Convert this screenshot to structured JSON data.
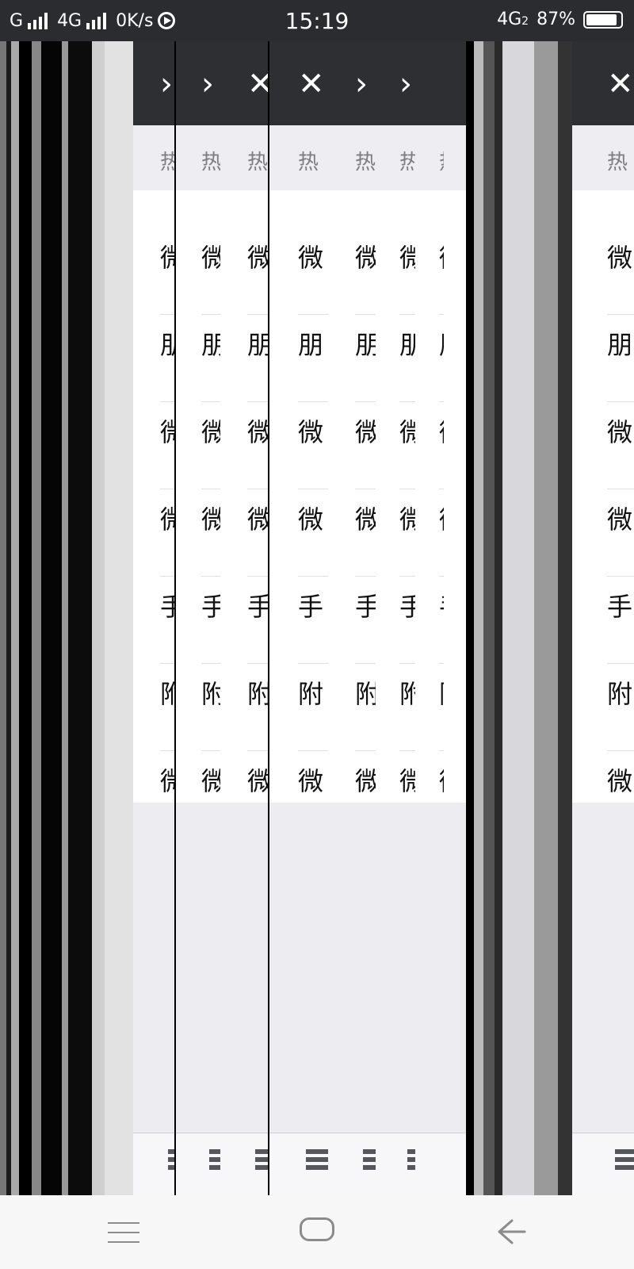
{
  "status_bar": {
    "carrier_1": "G",
    "carrier_2": "4G",
    "speed": "0K/s",
    "time": "15:19",
    "network": "4G",
    "network_sub": "2",
    "battery": "87%"
  },
  "page": {
    "header_text": "热",
    "list_items": [
      "微",
      "朋",
      "微",
      "微",
      "手",
      "附",
      "微"
    ]
  },
  "system_nav": {
    "menu_icon": "menu-icon",
    "home_icon": "home-icon",
    "back_icon": "back-icon"
  },
  "colors": {
    "nav_bar": "#2e2f33",
    "status_bar": "#2b2c30",
    "section_header_bg": "#ededf2",
    "list_bg": "#ffffff",
    "empty_bg": "#ececf1"
  }
}
